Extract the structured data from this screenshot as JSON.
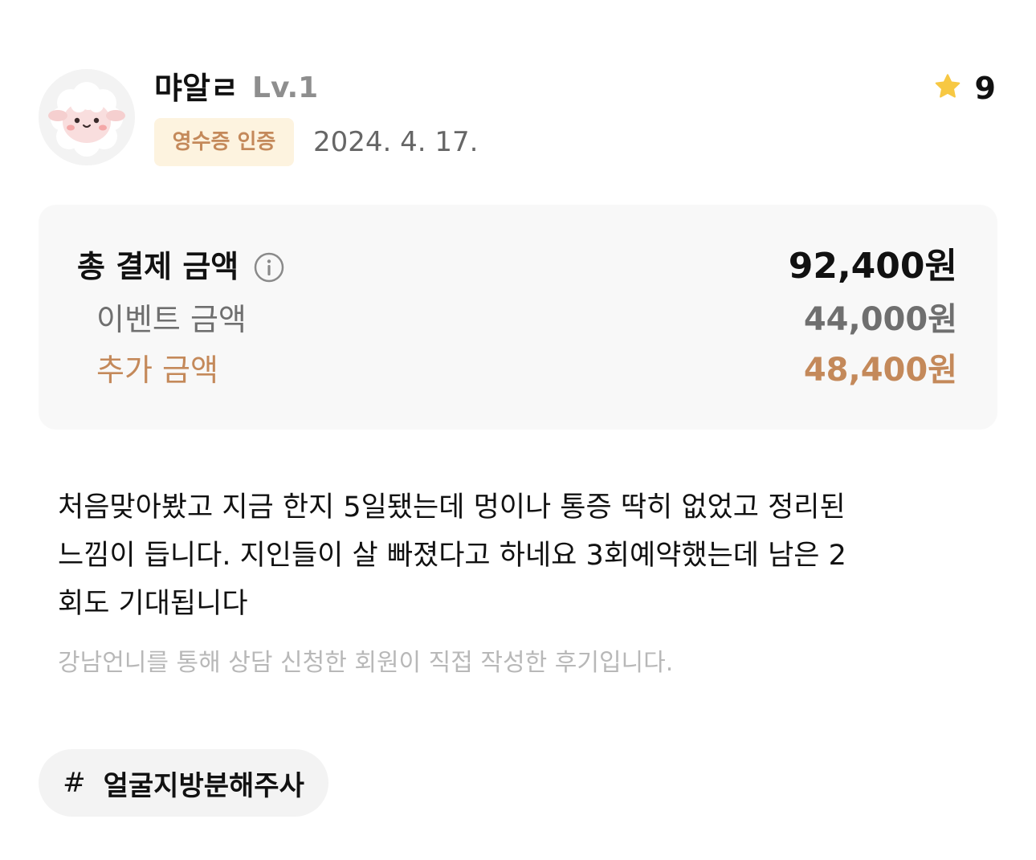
{
  "user": {
    "name": "먀알ㄹ",
    "level": "Lv.1",
    "avatar_icon": "sheep-avatar-icon"
  },
  "review": {
    "badge": "영수증 인증",
    "date": "2024. 4. 17.",
    "rating_icon": "star-icon",
    "rating": "9",
    "text_lines": [
      "처음맞아봤고 지금 한지 5일됐는데 멍이나 통증 딱히 없었고 정리된",
      "느낌이 듭니다. 지인들이 살 빠졌다고 하네요 3회예약했는데 남은 2",
      "회도 기대됩니다"
    ],
    "disclaimer": "강남언니를 통해 상담 신청한 회원이 직접 작성한 후기입니다."
  },
  "price": {
    "total_label": "총 결제 금액",
    "total_amount": "92,400원",
    "event_label": "이벤트 금액",
    "event_amount": "44,000원",
    "extra_label": "추가 금액",
    "extra_amount": "48,400원",
    "info_icon": "info-icon"
  },
  "tags": [
    {
      "hash": "#",
      "label": "얼굴지방분해주사"
    }
  ],
  "colors": {
    "accent": "#c4895a",
    "badge_bg": "#fdf3df",
    "star": "#f7c843",
    "muted": "#6f6f6f",
    "box_bg": "#f8f8f8"
  }
}
